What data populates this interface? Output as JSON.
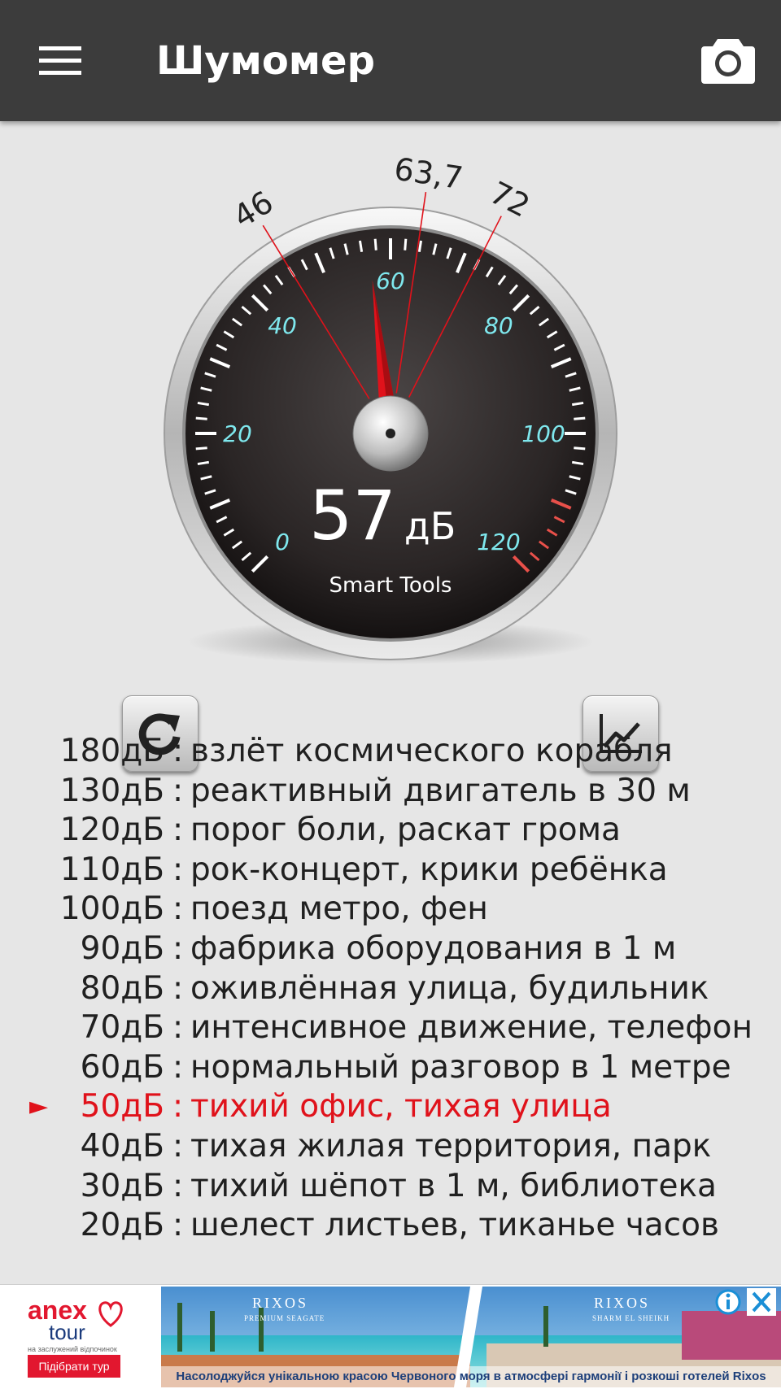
{
  "app": {
    "title": "Шумомер"
  },
  "icons": {
    "menu": "menu-icon",
    "camera": "camera-icon",
    "reset": "refresh-icon",
    "chart": "line-chart-icon",
    "selected_row": "arrow-right-icon"
  },
  "colors": {
    "appbar": "#3c3c3c",
    "background": "#e6e6e6",
    "tick_labels": "#7fe8ee",
    "needle": "#e0121b",
    "selected_row": "#e0121b",
    "danger_ticks": "#e8504a"
  },
  "gauge": {
    "scale_labels": [
      "0",
      "20",
      "40",
      "60",
      "80",
      "100",
      "120"
    ],
    "scale_min": 0,
    "scale_max": 120,
    "current_value": 57,
    "value_text": "57",
    "unit": "дБ",
    "brand": "Smart Tools",
    "markers": [
      {
        "label": "46",
        "value": 46
      },
      {
        "label": "63,7",
        "value": 63.7
      },
      {
        "label": "72",
        "value": 72
      }
    ]
  },
  "reference": [
    {
      "level": "180дБ",
      "desc": "взлёт космического корабля"
    },
    {
      "level": "130дБ",
      "desc": "реактивный двигатель в 30 м"
    },
    {
      "level": "120дБ",
      "desc": "порог боли, раскат грома"
    },
    {
      "level": "110дБ",
      "desc": "рок-концерт, крики ребёнка"
    },
    {
      "level": "100дБ",
      "desc": "поезд метро, фен"
    },
    {
      "level": "90дБ",
      "desc": "фабрика оборудования в 1 м"
    },
    {
      "level": "80дБ",
      "desc": "оживлённая улица, будильник"
    },
    {
      "level": "70дБ",
      "desc": "интенсивное движение, телефон"
    },
    {
      "level": "60дБ",
      "desc": "нормальный разговор в 1 метре"
    },
    {
      "level": "50дБ",
      "desc": "тихий офис, тихая улица",
      "selected": true
    },
    {
      "level": "40дБ",
      "desc": "тихая жилая территория, парк"
    },
    {
      "level": "30дБ",
      "desc": "тихий шёпот в 1 м, библиотека"
    },
    {
      "level": "20дБ",
      "desc": "шелест листьев, тиканье часов"
    }
  ],
  "ad": {
    "brand_anex": "anex",
    "brand_tour": "tour",
    "tagline": "на заслужений відпочинок",
    "cta": "Підібрати тур",
    "hotel_1": "RIXOS",
    "hotel_1_sub": "PREMIUM SEAGATE",
    "hotel_2": "RIXOS",
    "hotel_2_sub": "SHARM EL SHEIKH",
    "caption": "Насолоджуйся унікальною красою Червоного моря в атмосфері гармонії і розкоші готелей Rixos"
  }
}
